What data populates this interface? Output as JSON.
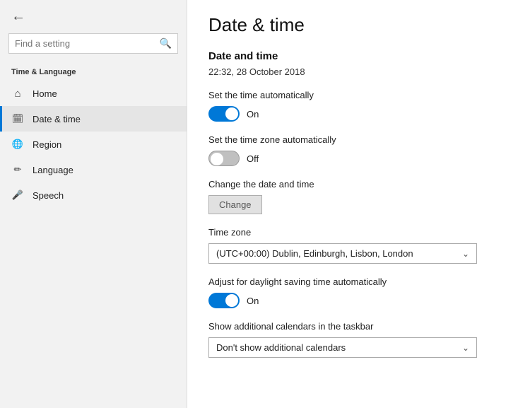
{
  "sidebar": {
    "search_placeholder": "Find a setting",
    "section_label": "Time & Language",
    "nav_items": [
      {
        "id": "home",
        "label": "Home",
        "icon": "⌂"
      },
      {
        "id": "date-time",
        "label": "Date & time",
        "icon": "📅",
        "active": true
      },
      {
        "id": "region",
        "label": "Region",
        "icon": "🌐"
      },
      {
        "id": "language",
        "label": "Language",
        "icon": "✏"
      },
      {
        "id": "speech",
        "label": "Speech",
        "icon": "🎤"
      }
    ]
  },
  "main": {
    "page_title": "Date & time",
    "section_date_time": "Date and time",
    "current_datetime": "22:32, 28 October 2018",
    "set_time_auto_label": "Set the time automatically",
    "set_time_auto_state": "On",
    "set_timezone_auto_label": "Set the time zone automatically",
    "set_timezone_auto_state": "Off",
    "change_datetime_label": "Change the date and time",
    "change_btn_label": "Change",
    "timezone_label": "Time zone",
    "timezone_value": "(UTC+00:00) Dublin, Edinburgh, Lisbon, London",
    "daylight_label": "Adjust for daylight saving time automatically",
    "daylight_state": "On",
    "additional_calendars_label": "Show additional calendars in the taskbar",
    "additional_calendars_value": "Don't show additional calendars"
  }
}
